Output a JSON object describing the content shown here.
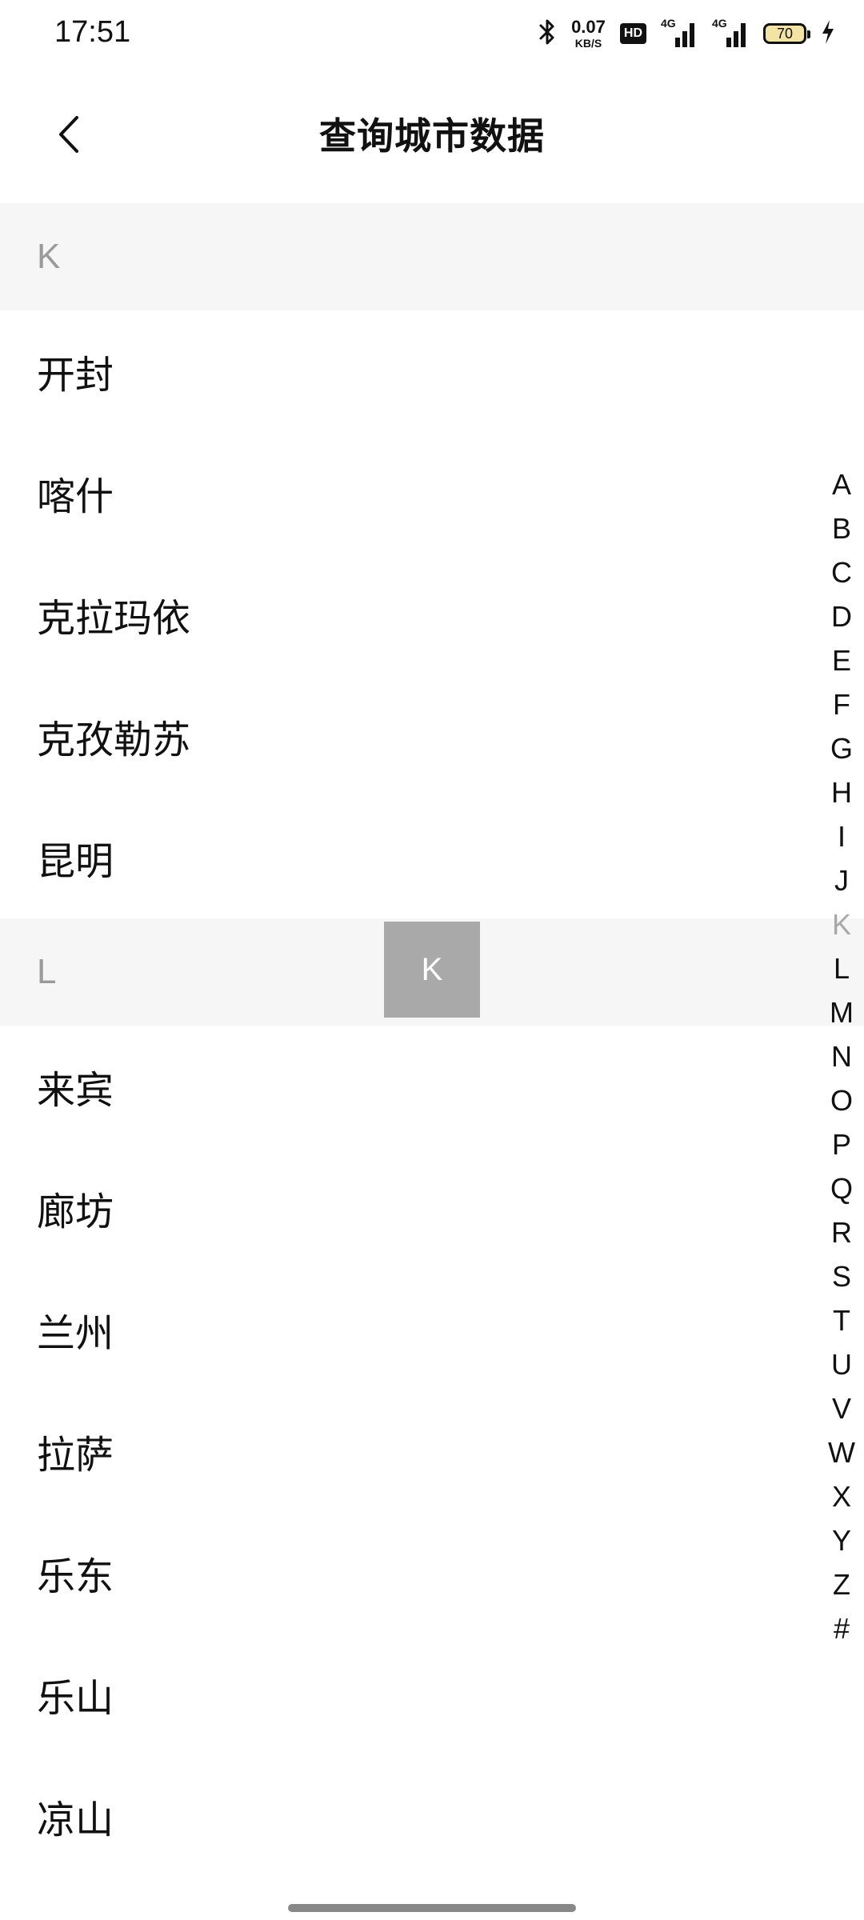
{
  "status_bar": {
    "time": "17:51",
    "net_speed_value": "0.07",
    "net_speed_unit": "KB/S",
    "hd_label": "HD",
    "signal1_label": "4G",
    "signal2_label": "4G",
    "battery_level": "70",
    "icons": [
      "bluetooth-icon",
      "hd-icon",
      "signal-icon",
      "signal-icon",
      "battery-icon",
      "charging-icon"
    ]
  },
  "header": {
    "title": "查询城市数据",
    "back_icon": "chevron-left-icon"
  },
  "sections": [
    {
      "letter": "K",
      "cities": [
        "开封",
        "喀什",
        "克拉玛依",
        "克孜勒苏",
        "昆明"
      ]
    },
    {
      "letter": "L",
      "cities": [
        "来宾",
        "廊坊",
        "兰州",
        "拉萨",
        "乐东",
        "乐山",
        "凉山"
      ]
    }
  ],
  "index_bar": {
    "letters": [
      "A",
      "B",
      "C",
      "D",
      "E",
      "F",
      "G",
      "H",
      "I",
      "J",
      "K",
      "L",
      "M",
      "N",
      "O",
      "P",
      "Q",
      "R",
      "S",
      "T",
      "U",
      "V",
      "W",
      "X",
      "Y",
      "Z",
      "#"
    ],
    "active": "K"
  },
  "overlay_letter": "K",
  "colors": {
    "section_bg": "#f6f6f6",
    "section_text": "#9a9a9a",
    "overlay_bg": "#a9a9a9",
    "active_index": "#a8a8a8",
    "battery_fill": "#f3e4a3"
  }
}
